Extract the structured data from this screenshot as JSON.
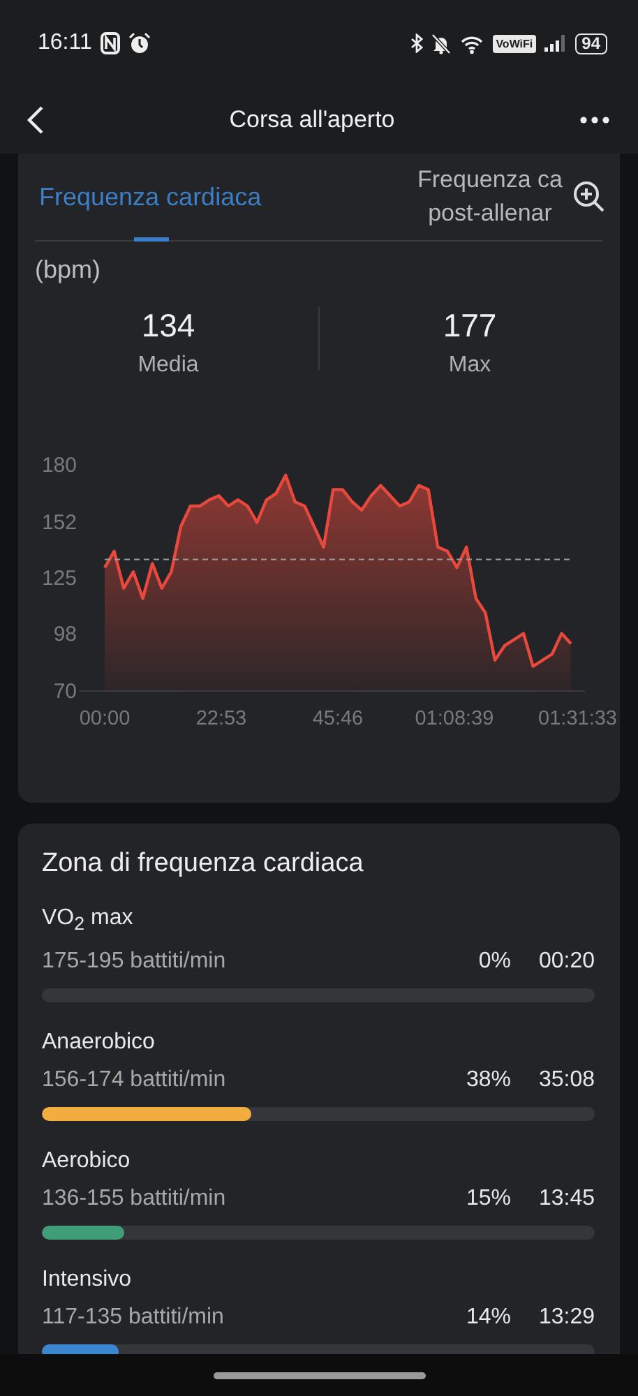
{
  "status_bar": {
    "time": "16:11",
    "wifi_label": "VoWiFi",
    "battery": "94"
  },
  "app_bar": {
    "title": "Corsa all'aperto"
  },
  "heart_rate_card": {
    "tabs": [
      {
        "label": "Frequenza cardiaca",
        "selected": true
      },
      {
        "label": "Frequenza ca post-allenar",
        "selected": false
      }
    ],
    "unit": "(bpm)",
    "stats": [
      {
        "value": "134",
        "label": "Media"
      },
      {
        "value": "177",
        "label": "Max"
      }
    ],
    "chart_data": {
      "type": "area",
      "ylim": [
        70,
        180
      ],
      "yticks": [
        70,
        98,
        125,
        152,
        180
      ],
      "x": [
        0,
        1.87,
        3.74,
        5.61,
        7.47,
        9.34,
        11.21,
        13.08,
        14.95,
        16.82,
        18.69,
        20.56,
        22.42,
        24.29,
        26.16,
        28.03,
        29.9,
        31.77,
        33.64,
        35.51,
        37.37,
        39.24,
        41.11,
        42.98,
        44.85,
        46.72,
        48.59,
        50.46,
        52.33,
        54.2,
        56.06,
        57.93,
        59.8,
        61.67,
        63.54,
        65.41,
        67.28,
        69.15,
        71.02,
        72.88,
        74.75,
        76.62,
        78.49,
        80.36,
        82.23,
        84.1,
        85.97,
        87.84,
        89.71,
        91.55
      ],
      "xlim": [
        0,
        91.55
      ],
      "xticks": [
        {
          "value": 0,
          "label": "00:00"
        },
        {
          "value": 22.88,
          "label": "22:53"
        },
        {
          "value": 45.77,
          "label": "45:46"
        },
        {
          "value": 68.65,
          "label": "01:08:39"
        },
        {
          "value": 91.55,
          "label": "01:31:33"
        }
      ],
      "ref_lines": [
        {
          "axis": "y",
          "value": 134
        }
      ],
      "series": [
        {
          "color": "#e8493c",
          "values": [
            130,
            138,
            120,
            128,
            115,
            132,
            120,
            128,
            150,
            160,
            160,
            163,
            165,
            160,
            163,
            160,
            152,
            163,
            166,
            175,
            162,
            160,
            150,
            140,
            168,
            168,
            162,
            158,
            165,
            170,
            165,
            160,
            162,
            170,
            168,
            140,
            138,
            130,
            140,
            115,
            108,
            85,
            92,
            95,
            98,
            82,
            85,
            88,
            98,
            93
          ]
        }
      ]
    }
  },
  "zone_card": {
    "title": "Zona di frequenza cardiaca",
    "zones": [
      {
        "name": "VO$_{2}$ max",
        "range": "175-195 battiti/min",
        "percent": "0%",
        "time": "00:20"
      },
      {
        "name": "Anaerobico",
        "range": "156-174 battiti/min",
        "percent": "38%",
        "time": "35:08",
        "level": 0.38,
        "color": "#f2ad3e"
      },
      {
        "name": "Aerobico",
        "range": "136-155 battiti/min",
        "percent": "15%",
        "time": "13:45",
        "level": 0.15,
        "color": "#3f9d78"
      },
      {
        "name": "Intensivo",
        "range": "117-135 battiti/min",
        "percent": "14%",
        "time": "13:29",
        "level": 0.14,
        "color": "#3a86d0"
      }
    ]
  }
}
